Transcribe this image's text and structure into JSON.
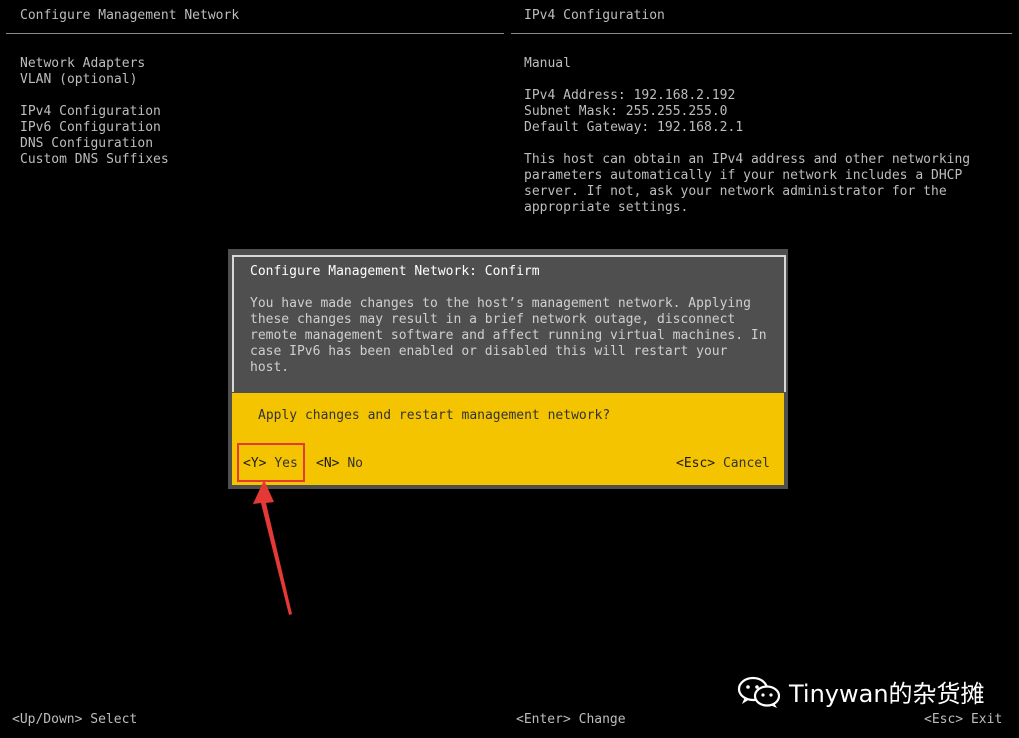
{
  "header": {
    "left_title": "Configure Management Network",
    "right_title": "IPv4 Configuration"
  },
  "menu": {
    "items": [
      {
        "label": "Network Adapters"
      },
      {
        "label": "VLAN (optional)"
      },
      {
        "label": "IPv4 Configuration"
      },
      {
        "label": "IPv6 Configuration"
      },
      {
        "label": "DNS Configuration"
      },
      {
        "label": "Custom DNS Suffixes"
      }
    ]
  },
  "ipv4": {
    "mode": "Manual",
    "address": "IPv4 Address: 192.168.2.192",
    "subnet": "Subnet Mask: 255.255.255.0",
    "gateway": "Default Gateway: 192.168.2.1",
    "description": "This host can obtain an IPv4 address and other networking parameters automatically if your network includes a DHCP server. If not, ask your network administrator for the appropriate settings."
  },
  "dialog": {
    "title": "Configure Management Network: Confirm",
    "body": "You have made changes to the host’s management network. Applying these changes may result in a brief network outage, disconnect remote management software and affect running virtual machines. In case IPv6 has been enabled or disabled this will restart your host.",
    "question": "Apply changes and restart management network?",
    "yes_key": "<Y>",
    "yes_label": "Yes",
    "no_key": "<N>",
    "no_label": "No",
    "cancel_key": "<Esc>",
    "cancel_label": "Cancel"
  },
  "footer": {
    "select_key": "<Up/Down>",
    "select_label": "Select",
    "change_key": "<Enter>",
    "change_label": "Change",
    "exit_key": "<Esc>",
    "exit_label": "Exit"
  },
  "watermark": {
    "icon": "wechat-icon",
    "text": "Tinywan的杂货摊"
  },
  "colors": {
    "background": "#000000",
    "text": "#bdbdbd",
    "dialog_bg": "#4f4f4f",
    "dialog_accent": "#f5c400",
    "highlight": "#e53935"
  }
}
